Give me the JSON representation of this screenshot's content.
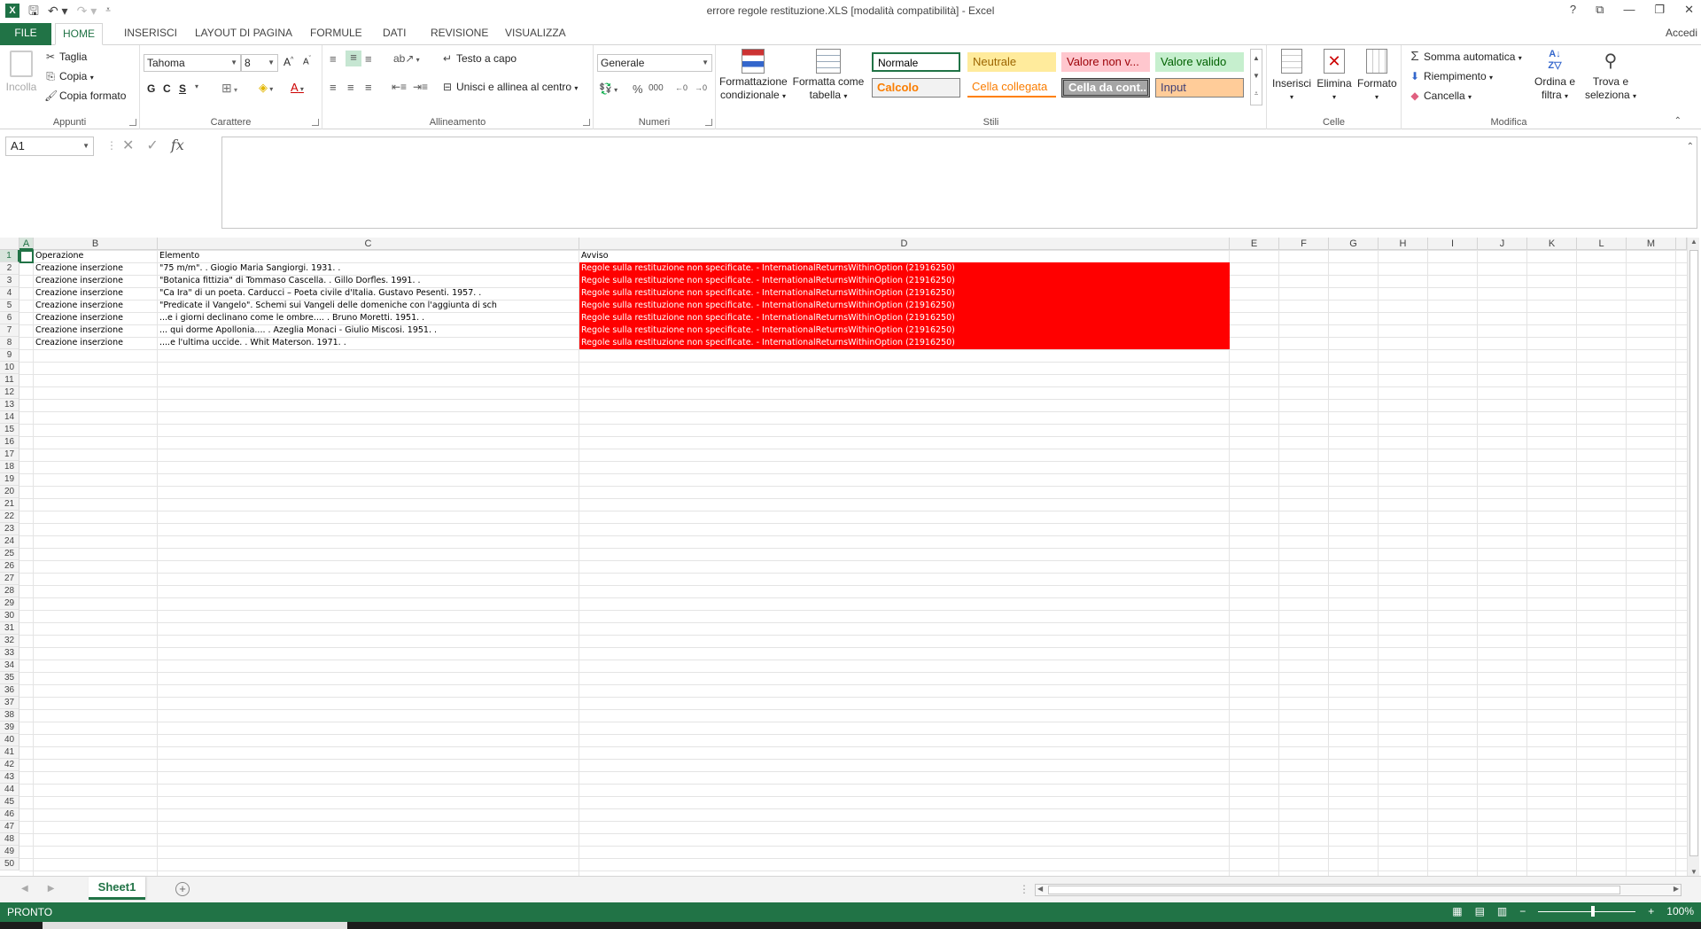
{
  "window": {
    "title": "errore regole restituzione.XLS  [modalità compatibilità] - Excel",
    "controls": [
      "?",
      "⧉",
      "—",
      "❐",
      "✕"
    ]
  },
  "ribbon_tabs": [
    "FILE",
    "HOME",
    "INSERISCI",
    "LAYOUT DI PAGINA",
    "FORMULE",
    "DATI",
    "REVISIONE",
    "VISUALIZZA"
  ],
  "active_tab": "HOME",
  "signin": "Accedi",
  "clipboard": {
    "paste": "Incolla",
    "cut": "Taglia",
    "copy": "Copia",
    "format_painter": "Copia formato",
    "label": "Appunti"
  },
  "font": {
    "name": "Tahoma",
    "size": "8",
    "bold": "G",
    "italic": "C",
    "underline": "S",
    "label": "Carattere"
  },
  "alignment": {
    "wrap": "Testo a capo",
    "merge": "Unisci e allinea al centro",
    "label": "Allineamento"
  },
  "number": {
    "format": "Generale",
    "label": "Numeri"
  },
  "styles": {
    "conditional": "Formattazione condizionale",
    "as_table": "Formatta come tabella",
    "cells": [
      "Normale",
      "Neutrale",
      "Valore non v...",
      "Valore valido",
      "Calcolo",
      "Cella collegata",
      "Cella da cont...",
      "Input"
    ],
    "label": "Stili"
  },
  "cells_group": {
    "insert": "Inserisci",
    "delete": "Elimina",
    "format": "Formato",
    "label": "Celle"
  },
  "editing": {
    "autosum": "Somma automatica",
    "fill": "Riempimento",
    "clear": "Cancella",
    "sort": "Ordina e filtra",
    "find": "Trova e seleziona",
    "label": "Modifica"
  },
  "formula_bar": {
    "name_box": "A1",
    "fx": "fx",
    "value": ""
  },
  "columns": [
    "A",
    "B",
    "C",
    "D",
    "E",
    "F",
    "G",
    "H",
    "I",
    "J",
    "K",
    "L",
    "M"
  ],
  "rows": [
    "1",
    "2",
    "3",
    "4",
    "5",
    "6",
    "7",
    "8",
    "9",
    "10",
    "11",
    "12",
    "13",
    "14",
    "15",
    "16",
    "17",
    "18",
    "19",
    "20",
    "21",
    "22",
    "23",
    "24",
    "25",
    "26",
    "27",
    "28",
    "29",
    "30",
    "31",
    "32",
    "33",
    "34",
    "35",
    "36",
    "37",
    "38",
    "39",
    "40",
    "41",
    "42",
    "43",
    "44",
    "45",
    "46",
    "47",
    "48",
    "49",
    "50"
  ],
  "table": {
    "headers": [
      "Operazione",
      "Elemento",
      "Avviso"
    ],
    "rows": [
      [
        "Creazione inserzione",
        "\"75 m/m\". . Giogio Maria Sangiorgi. 1931. .",
        "Regole sulla restituzione non specificate. - InternationalReturnsWithinOption (21916250)"
      ],
      [
        "Creazione inserzione",
        "\"Botanica fittizia\" di Tommaso Cascella. . Gillo Dorfles. 1991. .",
        "Regole sulla restituzione non specificate. - InternationalReturnsWithinOption (21916250)"
      ],
      [
        "Creazione inserzione",
        "\"Ca Ira\" di un poeta. Carducci – Poeta civile d'Italia. Gustavo Pesenti. 1957. .",
        "Regole sulla restituzione non specificate. - InternationalReturnsWithinOption (21916250)"
      ],
      [
        "Creazione inserzione",
        "\"Predicate il Vangelo\". Schemi sui Vangeli delle domeniche con l'aggiunta di sch",
        "Regole sulla restituzione non specificate. - InternationalReturnsWithinOption (21916250)"
      ],
      [
        "Creazione inserzione",
        "...e i giorni declinano come le ombre.... . Bruno Moretti. 1951. .",
        "Regole sulla restituzione non specificate. - InternationalReturnsWithinOption (21916250)"
      ],
      [
        "Creazione inserzione",
        "... qui dorme Apollonia.... . Azeglia Monaci - Giulio Miscosi. 1951. .",
        "Regole sulla restituzione non specificate. - InternationalReturnsWithinOption (21916250)"
      ],
      [
        "Creazione inserzione",
        "....e l'ultima uccide. . Whit Materson. 1971. .",
        "Regole sulla restituzione non specificate. - InternationalReturnsWithinOption (21916250)"
      ]
    ]
  },
  "sheets": [
    "Sheet1"
  ],
  "status": {
    "text": "PRONTO",
    "zoom": "100%"
  },
  "colors": {
    "brand": "#217346",
    "warning_fill": "#ff0000"
  }
}
